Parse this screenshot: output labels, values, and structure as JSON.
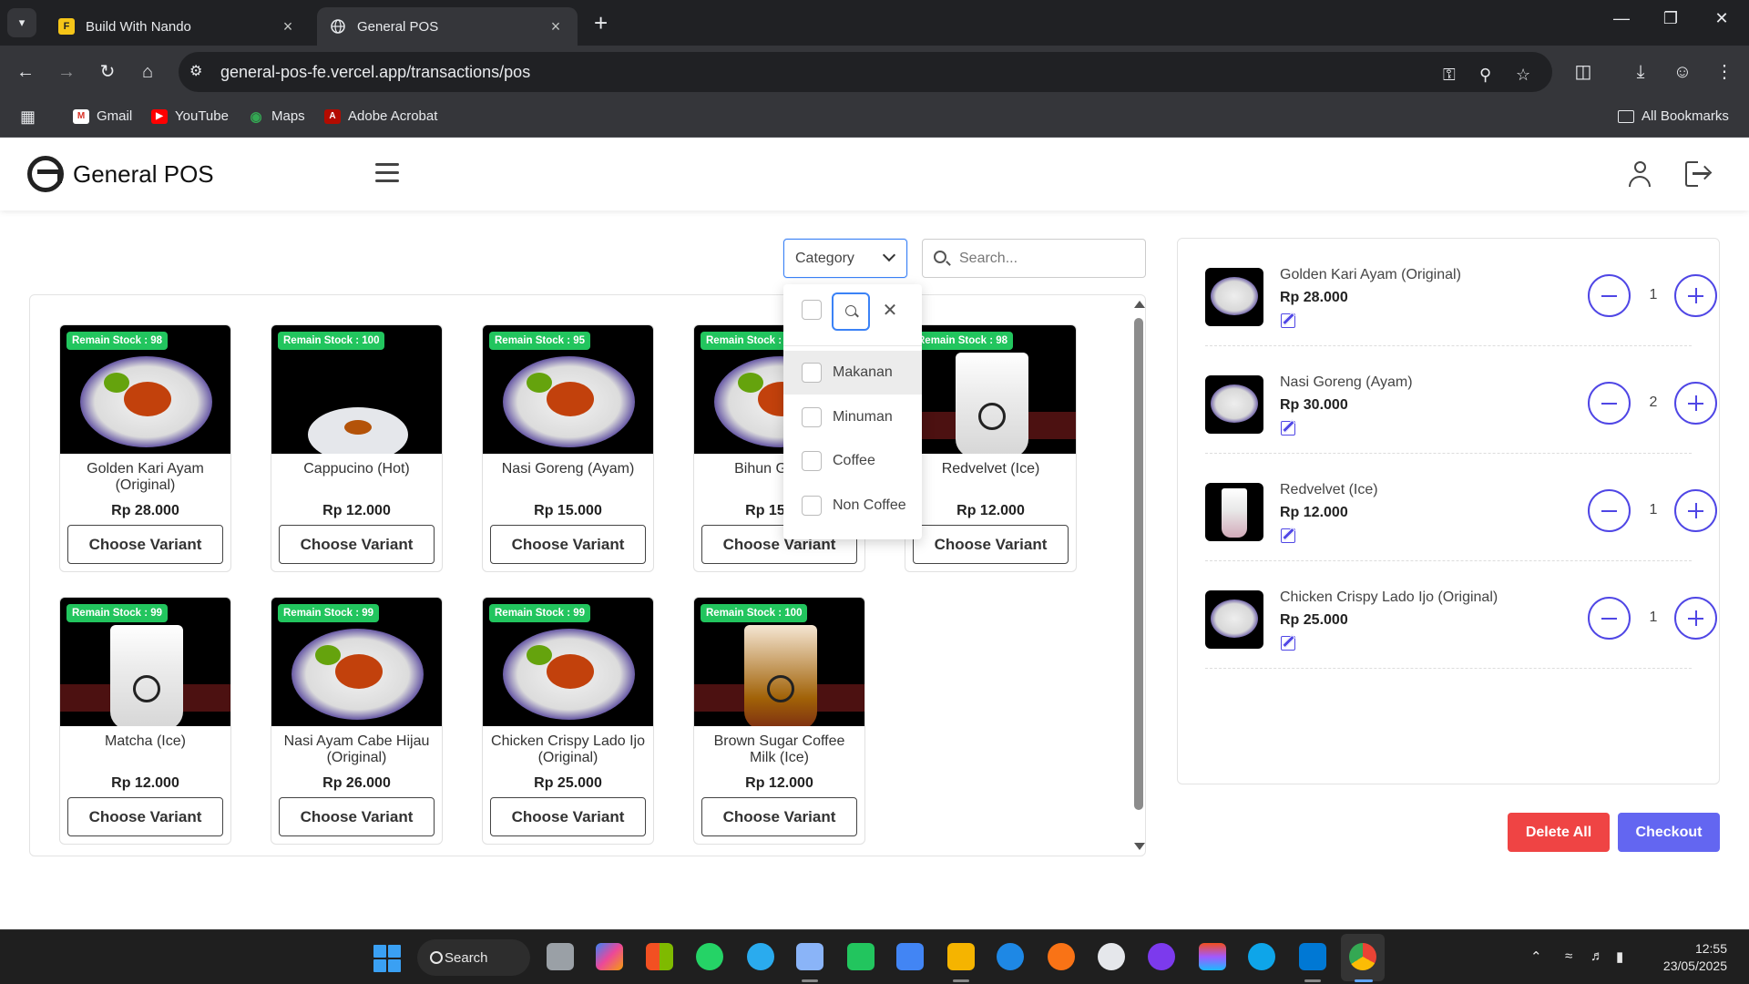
{
  "browser": {
    "tabs": [
      {
        "title": "Build With Nando",
        "active": false,
        "favicon": "F"
      },
      {
        "title": "General POS",
        "active": true,
        "favicon": "globe"
      }
    ],
    "url": "general-pos-fe.vercel.app/transactions/pos",
    "bookmarks": [
      "Gmail",
      "YouTube",
      "Maps",
      "Adobe Acrobat"
    ],
    "all_bookmarks": "All Bookmarks"
  },
  "app": {
    "title": "General POS"
  },
  "filters": {
    "category_label": "Category",
    "search_placeholder": "Search..."
  },
  "category_dropdown": {
    "options": [
      "Makanan",
      "Minuman",
      "Coffee",
      "Non Coffee"
    ],
    "highlighted": "Makanan"
  },
  "products": [
    {
      "name": "Golden Kari Ayam (Original)",
      "price": "Rp 28.000",
      "stock": "Remain Stock : 98",
      "button": "Choose Variant",
      "kind": "plate"
    },
    {
      "name": "Cappucino (Hot)",
      "price": "Rp 12.000",
      "stock": "Remain Stock : 100",
      "button": "Choose Variant",
      "kind": "cup-hot"
    },
    {
      "name": "Nasi Goreng (Ayam)",
      "price": "Rp 15.000",
      "stock": "Remain Stock : 95",
      "button": "Choose Variant",
      "kind": "plate"
    },
    {
      "name": "Bihun Goreng",
      "price": "Rp 15.000",
      "stock": "Remain Stock : 98",
      "button": "Choose Variant",
      "kind": "plate"
    },
    {
      "name": "Redvelvet (Ice)",
      "price": "Rp 12.000",
      "stock": "Remain Stock : 98",
      "button": "Choose Variant",
      "kind": "cup"
    },
    {
      "name": "Matcha (Ice)",
      "price": "Rp 12.000",
      "stock": "Remain Stock : 99",
      "button": "Choose Variant",
      "kind": "cup"
    },
    {
      "name": "Nasi Ayam Cabe Hijau (Original)",
      "price": "Rp 26.000",
      "stock": "Remain Stock : 99",
      "button": "Choose Variant",
      "kind": "plate"
    },
    {
      "name": "Chicken Crispy Lado Ijo (Original)",
      "price": "Rp 25.000",
      "stock": "Remain Stock : 99",
      "button": "Choose Variant",
      "kind": "plate"
    },
    {
      "name": "Brown Sugar Coffee Milk (Ice)",
      "price": "Rp 12.000",
      "stock": "Remain Stock : 100",
      "button": "Choose Variant",
      "kind": "cup-brown"
    }
  ],
  "cart": {
    "items": [
      {
        "name": "Golden Kari Ayam (Original)",
        "price": "Rp 28.000",
        "qty": "1",
        "kind": "plate"
      },
      {
        "name": "Nasi Goreng (Ayam)",
        "price": "Rp 30.000",
        "qty": "2",
        "kind": "plate"
      },
      {
        "name": "Redvelvet (Ice)",
        "price": "Rp 12.000",
        "qty": "1",
        "kind": "cup"
      },
      {
        "name": "Chicken Crispy Lado Ijo (Original)",
        "price": "Rp 25.000",
        "qty": "1",
        "kind": "plate"
      }
    ],
    "delete_all_label": "Delete All",
    "checkout_label": "Checkout"
  },
  "taskbar": {
    "search_label": "Search",
    "time": "12:55",
    "date": "23/05/2025"
  },
  "colors": {
    "accent": "#6366f1",
    "danger": "#ef4444",
    "stock_badge": "#22c55e",
    "focus": "#3b82f6"
  }
}
